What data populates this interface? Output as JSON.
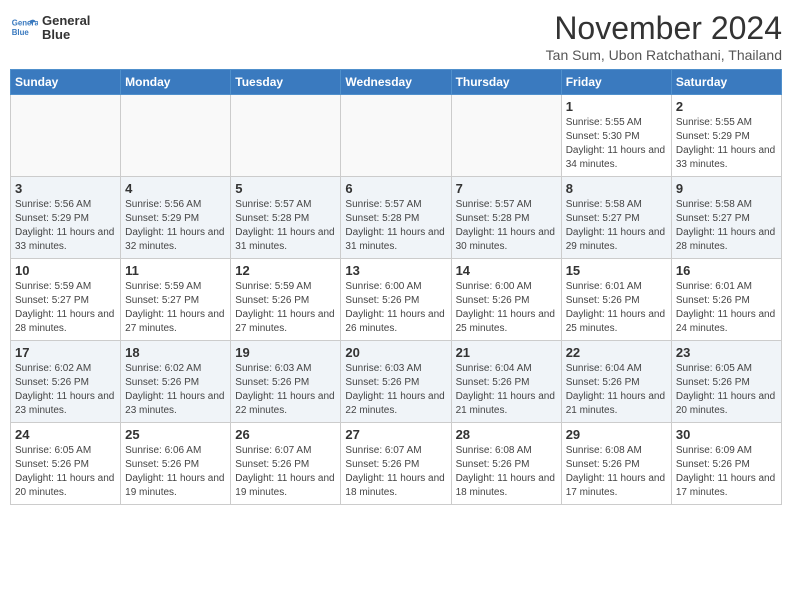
{
  "header": {
    "logo_line1": "General",
    "logo_line2": "Blue",
    "month": "November 2024",
    "location": "Tan Sum, Ubon Ratchathani, Thailand"
  },
  "weekdays": [
    "Sunday",
    "Monday",
    "Tuesday",
    "Wednesday",
    "Thursday",
    "Friday",
    "Saturday"
  ],
  "weeks": [
    [
      {
        "day": "",
        "info": ""
      },
      {
        "day": "",
        "info": ""
      },
      {
        "day": "",
        "info": ""
      },
      {
        "day": "",
        "info": ""
      },
      {
        "day": "",
        "info": ""
      },
      {
        "day": "1",
        "info": "Sunrise: 5:55 AM\nSunset: 5:30 PM\nDaylight: 11 hours\nand 34 minutes."
      },
      {
        "day": "2",
        "info": "Sunrise: 5:55 AM\nSunset: 5:29 PM\nDaylight: 11 hours\nand 33 minutes."
      }
    ],
    [
      {
        "day": "3",
        "info": "Sunrise: 5:56 AM\nSunset: 5:29 PM\nDaylight: 11 hours\nand 33 minutes."
      },
      {
        "day": "4",
        "info": "Sunrise: 5:56 AM\nSunset: 5:29 PM\nDaylight: 11 hours\nand 32 minutes."
      },
      {
        "day": "5",
        "info": "Sunrise: 5:57 AM\nSunset: 5:28 PM\nDaylight: 11 hours\nand 31 minutes."
      },
      {
        "day": "6",
        "info": "Sunrise: 5:57 AM\nSunset: 5:28 PM\nDaylight: 11 hours\nand 31 minutes."
      },
      {
        "day": "7",
        "info": "Sunrise: 5:57 AM\nSunset: 5:28 PM\nDaylight: 11 hours\nand 30 minutes."
      },
      {
        "day": "8",
        "info": "Sunrise: 5:58 AM\nSunset: 5:27 PM\nDaylight: 11 hours\nand 29 minutes."
      },
      {
        "day": "9",
        "info": "Sunrise: 5:58 AM\nSunset: 5:27 PM\nDaylight: 11 hours\nand 28 minutes."
      }
    ],
    [
      {
        "day": "10",
        "info": "Sunrise: 5:59 AM\nSunset: 5:27 PM\nDaylight: 11 hours\nand 28 minutes."
      },
      {
        "day": "11",
        "info": "Sunrise: 5:59 AM\nSunset: 5:27 PM\nDaylight: 11 hours\nand 27 minutes."
      },
      {
        "day": "12",
        "info": "Sunrise: 5:59 AM\nSunset: 5:26 PM\nDaylight: 11 hours\nand 27 minutes."
      },
      {
        "day": "13",
        "info": "Sunrise: 6:00 AM\nSunset: 5:26 PM\nDaylight: 11 hours\nand 26 minutes."
      },
      {
        "day": "14",
        "info": "Sunrise: 6:00 AM\nSunset: 5:26 PM\nDaylight: 11 hours\nand 25 minutes."
      },
      {
        "day": "15",
        "info": "Sunrise: 6:01 AM\nSunset: 5:26 PM\nDaylight: 11 hours\nand 25 minutes."
      },
      {
        "day": "16",
        "info": "Sunrise: 6:01 AM\nSunset: 5:26 PM\nDaylight: 11 hours\nand 24 minutes."
      }
    ],
    [
      {
        "day": "17",
        "info": "Sunrise: 6:02 AM\nSunset: 5:26 PM\nDaylight: 11 hours\nand 23 minutes."
      },
      {
        "day": "18",
        "info": "Sunrise: 6:02 AM\nSunset: 5:26 PM\nDaylight: 11 hours\nand 23 minutes."
      },
      {
        "day": "19",
        "info": "Sunrise: 6:03 AM\nSunset: 5:26 PM\nDaylight: 11 hours\nand 22 minutes."
      },
      {
        "day": "20",
        "info": "Sunrise: 6:03 AM\nSunset: 5:26 PM\nDaylight: 11 hours\nand 22 minutes."
      },
      {
        "day": "21",
        "info": "Sunrise: 6:04 AM\nSunset: 5:26 PM\nDaylight: 11 hours\nand 21 minutes."
      },
      {
        "day": "22",
        "info": "Sunrise: 6:04 AM\nSunset: 5:26 PM\nDaylight: 11 hours\nand 21 minutes."
      },
      {
        "day": "23",
        "info": "Sunrise: 6:05 AM\nSunset: 5:26 PM\nDaylight: 11 hours\nand 20 minutes."
      }
    ],
    [
      {
        "day": "24",
        "info": "Sunrise: 6:05 AM\nSunset: 5:26 PM\nDaylight: 11 hours\nand 20 minutes."
      },
      {
        "day": "25",
        "info": "Sunrise: 6:06 AM\nSunset: 5:26 PM\nDaylight: 11 hours\nand 19 minutes."
      },
      {
        "day": "26",
        "info": "Sunrise: 6:07 AM\nSunset: 5:26 PM\nDaylight: 11 hours\nand 19 minutes."
      },
      {
        "day": "27",
        "info": "Sunrise: 6:07 AM\nSunset: 5:26 PM\nDaylight: 11 hours\nand 18 minutes."
      },
      {
        "day": "28",
        "info": "Sunrise: 6:08 AM\nSunset: 5:26 PM\nDaylight: 11 hours\nand 18 minutes."
      },
      {
        "day": "29",
        "info": "Sunrise: 6:08 AM\nSunset: 5:26 PM\nDaylight: 11 hours\nand 17 minutes."
      },
      {
        "day": "30",
        "info": "Sunrise: 6:09 AM\nSunset: 5:26 PM\nDaylight: 11 hours\nand 17 minutes."
      }
    ]
  ]
}
